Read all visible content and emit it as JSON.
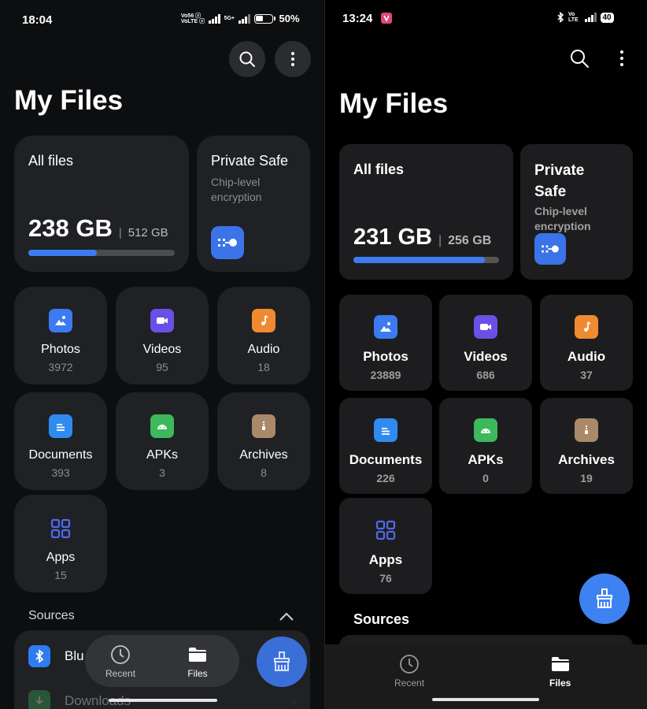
{
  "left": {
    "status": {
      "time": "18:04",
      "net1": "Vo56 ⓢ",
      "net2": "VoLTE ⓢ",
      "net3": "5G+",
      "battery": "50%",
      "battery_level": 0.5
    },
    "title": "My Files",
    "all_files": {
      "label": "All files",
      "used": "238 GB",
      "separator": "|",
      "total": "512 GB",
      "usage_fraction": 0.47
    },
    "private_safe": {
      "title": "Private Safe",
      "subtitle": "Chip-level encryption"
    },
    "categories": [
      {
        "label": "Photos",
        "count": "3972",
        "icon": "photo-icon"
      },
      {
        "label": "Videos",
        "count": "95",
        "icon": "video-icon"
      },
      {
        "label": "Audio",
        "count": "18",
        "icon": "music-icon"
      },
      {
        "label": "Documents",
        "count": "393",
        "icon": "document-icon"
      },
      {
        "label": "APKs",
        "count": "3",
        "icon": "android-icon"
      },
      {
        "label": "Archives",
        "count": "8",
        "icon": "archive-icon"
      },
      {
        "label": "Apps",
        "count": "15",
        "icon": "apps-grid-icon"
      }
    ],
    "sources_label": "Sources",
    "sources": [
      {
        "label": "Blu",
        "icon": "bluetooth-icon"
      },
      {
        "label": "Downloads",
        "icon": "download-icon"
      }
    ],
    "nav": {
      "recent": "Recent",
      "files": "Files"
    },
    "fab_icon": "cleaner-broom-icon"
  },
  "right": {
    "status": {
      "time": "13:24",
      "net": "Vo LTE",
      "battery": "40",
      "battery_level": 0.4
    },
    "title": "My Files",
    "all_files": {
      "label": "All files",
      "used": "231 GB",
      "separator": "|",
      "total": "256 GB",
      "usage_fraction": 0.9
    },
    "private_safe": {
      "title_line1": "Private",
      "title_line2": "Safe",
      "subtitle_line1": "Chip-level",
      "subtitle_line2": "encryption"
    },
    "categories": [
      {
        "label": "Photos",
        "count": "23889",
        "icon": "photo-icon"
      },
      {
        "label": "Videos",
        "count": "686",
        "icon": "video-icon"
      },
      {
        "label": "Audio",
        "count": "37",
        "icon": "music-icon"
      },
      {
        "label": "Documents",
        "count": "226",
        "icon": "document-icon"
      },
      {
        "label": "APKs",
        "count": "0",
        "icon": "android-icon"
      },
      {
        "label": "Archives",
        "count": "19",
        "icon": "archive-icon"
      },
      {
        "label": "Apps",
        "count": "76",
        "icon": "apps-grid-icon"
      }
    ],
    "sources_label": "Sources",
    "nav": {
      "recent": "Recent",
      "files": "Files"
    },
    "fab_icon": "cleaner-broom-icon"
  },
  "colors": {
    "accent": "#3d7cf0",
    "photos": "#3b7af0",
    "videos": "#6b4fe6",
    "audio": "#f08a30",
    "documents": "#2f8bf0",
    "apks": "#3db85a",
    "archives": "#a9896a",
    "apps": "#4f6af0"
  }
}
